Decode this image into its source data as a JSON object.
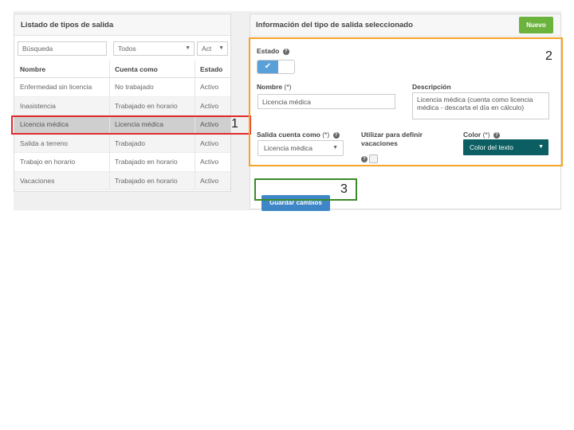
{
  "left_panel": {
    "title": "Listado de tipos de salida",
    "filters": {
      "search_placeholder": "Búsqueda",
      "type_value": "Todos",
      "status_value": "Act"
    },
    "columns": [
      "Nombre",
      "Cuenta como",
      "Estado"
    ],
    "rows": [
      {
        "name": "Enfermedad sin licencia",
        "counts_as": "No trabajado",
        "status": "Activo"
      },
      {
        "name": "Inasistencia",
        "counts_as": "Trabajado en horario",
        "status": "Activo"
      },
      {
        "name": "Licencia médica",
        "counts_as": "Licencia médica",
        "status": "Activo",
        "selected": true
      },
      {
        "name": "Salida a terreno",
        "counts_as": "Trabajado",
        "status": "Activo"
      },
      {
        "name": "Trabajo en horario",
        "counts_as": "Trabajado en horario",
        "status": "Activo"
      },
      {
        "name": "Vacaciones",
        "counts_as": "Trabajado en horario",
        "status": "Activo"
      }
    ]
  },
  "right_panel": {
    "title": "Información del tipo de salida seleccionado",
    "new_button": "Nuevo",
    "estado_label": "Estado",
    "estado_toggle": "✔",
    "nombre_label": "Nombre",
    "nombre_required": "(*)",
    "nombre_value": "Licencia médica",
    "descripcion_label": "Descripción",
    "descripcion_value": "Licencia médica (cuenta como licencia médica - descarta el día en cálculo)",
    "salida_cuenta_label": "Salida cuenta como",
    "salida_cuenta_required": "(*)",
    "salida_cuenta_value": "Licencia médica",
    "vacaciones_label_1": "Utilizar para definir",
    "vacaciones_label_2": "vacaciones",
    "color_label": "Color",
    "color_required": "(*)",
    "color_value": "Color del texto",
    "color_swatch": "#0b5e61",
    "save_button": "Guardar cambios",
    "help_glyph": "?"
  },
  "annotations": [
    "1",
    "2",
    "3"
  ],
  "colors": {
    "annotation_1": "#e02a2a",
    "annotation_2": "#f5a329",
    "annotation_3": "#3a8a2a",
    "new_button": "#6cb33e",
    "save_button": "#3e86c6",
    "toggle_on": "#5aa0d8"
  }
}
